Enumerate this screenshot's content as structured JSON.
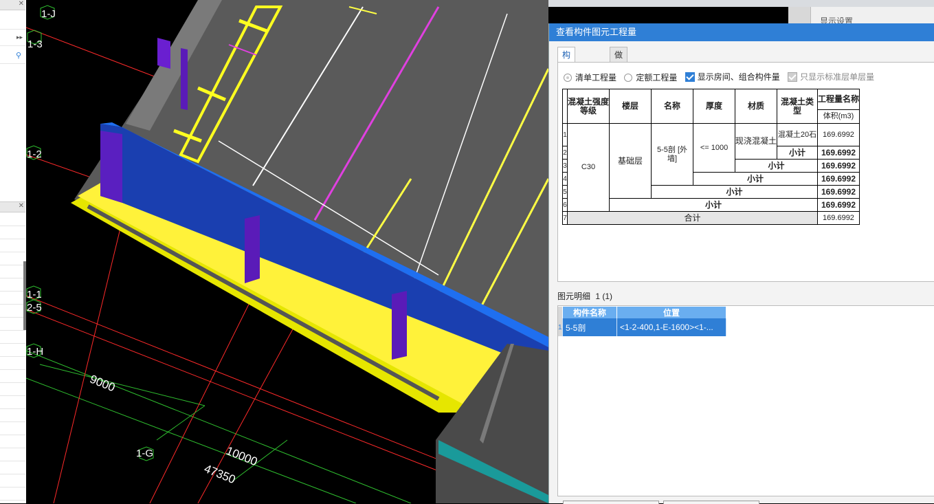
{
  "viewport": {
    "axis_labels": [
      "1-J",
      "1-3",
      "1-2",
      "1-1",
      "2-5",
      "1-H",
      "1-G"
    ],
    "dimensions": [
      "9000",
      "10000",
      "47350"
    ]
  },
  "display_settings_label": "显示设置",
  "dialog": {
    "title": "查看构件图元工程量",
    "tabs": [
      {
        "label": "构件工程量",
        "active": true
      },
      {
        "label": "做法工程量",
        "active": false
      }
    ],
    "options": [
      {
        "type": "radio",
        "label": "清单工程量",
        "checked": true
      },
      {
        "type": "radio",
        "label": "定额工程量",
        "checked": false
      },
      {
        "type": "checkbox",
        "label": "显示房间、组合构件量",
        "checked": true
      },
      {
        "type": "checkbox",
        "label": "只显示标准层单层量",
        "checked": true,
        "disabled": true
      }
    ],
    "table": {
      "headers": [
        "混凝土强度等级",
        "楼层",
        "名称",
        "厚度",
        "材质",
        "混凝土类型",
        "工程量名称"
      ],
      "sub_header": "体积(m3)",
      "row_numbers": [
        "1",
        "2",
        "3",
        "4",
        "5",
        "6",
        "7"
      ],
      "grade": "C30",
      "floor": "基础层",
      "name": "5-5剖 [外墙]",
      "thickness": "<= 1000",
      "material": "现浇混凝土",
      "concrete_type": "混凝土20石",
      "subtotal_label": "小计",
      "total_label": "合计",
      "values": [
        "169.6992",
        "169.6992",
        "169.6992",
        "169.6992",
        "169.6992",
        "169.6992",
        "169.6992"
      ]
    },
    "detail": {
      "label": "图元明细",
      "count": "1 (1)",
      "headers": [
        "构件名称",
        "位置"
      ],
      "rows": [
        {
          "index": "1",
          "name": "5-5剖",
          "position": "<1-2-400,1-E-1600><1-..."
        }
      ]
    }
  }
}
